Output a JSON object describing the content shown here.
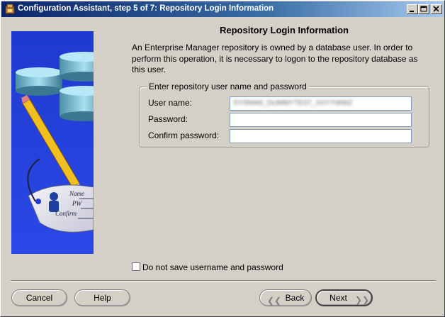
{
  "window": {
    "title": "Configuration Assistant, step 5 of 7: Repository Login Information"
  },
  "page": {
    "heading": "Repository Login Information",
    "description": "An Enterprise Manager repository is owned by a database user.  In order to perform this operation, it is necessary to logon to the repository database as this user."
  },
  "group": {
    "legend": "Enter repository user name and password",
    "username_label": "User name:",
    "username_value": "SYSMAN_DUMMYTEST_XXYYWWZ",
    "password_label": "Password:",
    "password_value": "",
    "confirm_label": "Confirm password:",
    "confirm_value": ""
  },
  "checkbox": {
    "label": "Do not save username and password",
    "checked": false
  },
  "illustration": {
    "tag_lines": [
      "Name",
      "PW",
      "Confirm"
    ]
  },
  "buttons": {
    "cancel": "Cancel",
    "help": "Help",
    "back": "Back",
    "next": "Next"
  },
  "colors": {
    "titlebar_start": "#0a246a",
    "titlebar_end": "#a6caf0",
    "panel_blue": "#1a3cd8",
    "dialog_bg": "#d4d0c8"
  }
}
